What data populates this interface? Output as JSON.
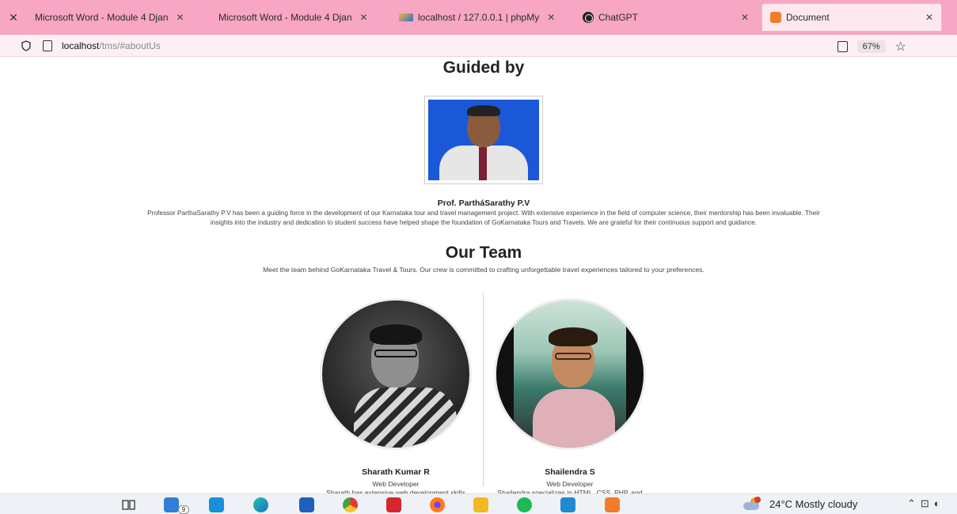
{
  "browser": {
    "tabs": [
      {
        "label": "Microsoft Word - Module 4 Djan"
      },
      {
        "label": "Microsoft Word - Module 4 Djan"
      },
      {
        "label": "localhost / 127.0.0.1 | phpMy"
      },
      {
        "label": "ChatGPT"
      },
      {
        "label": "Document"
      }
    ],
    "url_host": "localhost",
    "url_path": "/tms/#aboutUs",
    "zoom": "67%"
  },
  "guide": {
    "heading": "Guided by",
    "name": "Prof. PartháSarathy P.V",
    "description": "Professor ParthaSarathy P.V has been a guiding force in the development of our Karnataka tour and travel management project. With extensive experience in the field of computer science, their mentorship has been invaluable. Their insights into the industry and dedication to student success have helped shape the foundation of GoKarnataka Tours and Travels. We are grateful for their continuous support and guidance."
  },
  "team": {
    "heading": "Our Team",
    "intro": "Meet the team behind GoKarnataka Travel & Tours. Our crew is committed to crafting unforgettable travel experiences tailored to your preferences.",
    "members": [
      {
        "name": "Sharath Kumar R",
        "role": "Web Developer",
        "description": "Sharath has extensive web development skills with expertise in HTML, CSS, and JavaScript. His deep knowledge of the tourism industry helped in showcasing Karnataka's beauty."
      },
      {
        "name": "Shailendra S",
        "role": "Web Developer",
        "description": "Shailendra specializes in HTML, CSS, PHP, and JavaScript, developing unique features tailored to clients' needs. His understanding of heritage ensures each journey is unique and memorable."
      }
    ]
  },
  "taskbar": {
    "mail_badge": "9",
    "weather": "24°C  Mostly cloudy"
  },
  "colors": {
    "tabbar": "#f7a6c3",
    "accent_doc": "#f07d2a"
  }
}
